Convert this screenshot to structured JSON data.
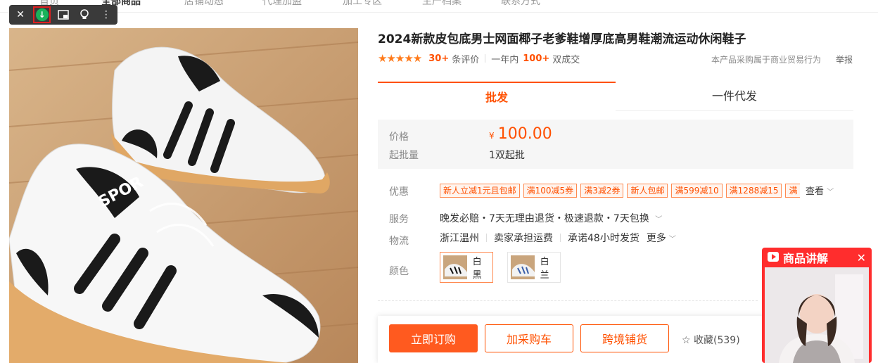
{
  "nav": {
    "items": [
      "首页",
      "全部商品",
      "店铺动态",
      "代理加盟",
      "加工专区",
      "生产档案",
      "联系方式"
    ]
  },
  "toolbar": {
    "close_icon": "close-icon",
    "download_icon": "download-icon",
    "pip_icon": "picture-in-picture-icon",
    "idea_icon": "lightbulb-icon",
    "more_icon": "more-vertical-icon"
  },
  "product": {
    "title": "2024新款皮包底男士网面椰子老爹鞋增厚底高男鞋潮流运动休闲鞋子",
    "rating_stars": "★★★★★",
    "rating_value": 4.5,
    "review_count": "30+",
    "review_label": "条评价",
    "year_label": "一年内",
    "deals_count": "100+",
    "deals_label": "双成交",
    "trade_note": "本产品采购属于商业贸易行为",
    "report_label": "举报"
  },
  "tabs": [
    {
      "label": "批发"
    },
    {
      "label": "一件代发"
    }
  ],
  "pricing": {
    "price_label": "价格",
    "currency": "¥",
    "price": "100.00",
    "moq_label": "起批量",
    "moq_value": "1双起批"
  },
  "promo": {
    "label": "优惠",
    "coupons": [
      "新人立减1元且包邮",
      "满100减5券",
      "满3减2券",
      "新人包邮",
      "满599减10",
      "满1288减15",
      "满"
    ],
    "view_label": "查看"
  },
  "service": {
    "label": "服务",
    "text": "晚发必赔・7天无理由退货・极速退款・7天包换"
  },
  "logistics": {
    "label": "物流",
    "origin": "浙江温州",
    "freight": "卖家承担运费",
    "promise": "承诺48小时发货",
    "more": "更多"
  },
  "color": {
    "label": "颜色",
    "options": [
      {
        "name": "白黑",
        "selected": true
      },
      {
        "name": "白兰",
        "selected": false
      }
    ]
  },
  "actions": {
    "buy": "立即订购",
    "cart": "加采购车",
    "cross": "跨境铺货",
    "favorite": "收藏(539)"
  },
  "live": {
    "title": "商品讲解"
  },
  "colors": {
    "accent": "#ff5000",
    "live_bg": "#ff2d2d",
    "download_green": "#19b35a"
  }
}
